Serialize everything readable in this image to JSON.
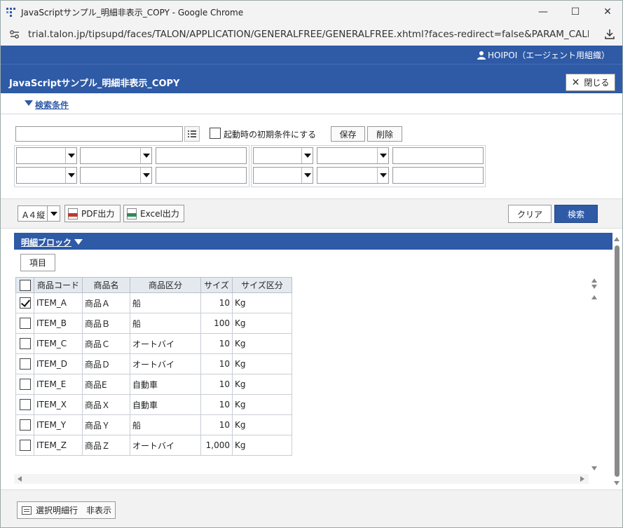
{
  "window": {
    "title": "JavaScriptサンプル_明細非表示_COPY - Google Chrome",
    "minimize": "—",
    "maximize": "☐",
    "close": "✕"
  },
  "address": {
    "url": "trial.talon.jp/tipsupd/faces/TALON/APPLICATION/GENERALFREE/GENERALFREE.xhtml?faces-redirect=false&PARAM_CALL_FUN..."
  },
  "header": {
    "user": "HOIPOI（エージェント用組織）",
    "title": "JavaScriptサンプル_明細非表示_COPY",
    "close_label": "閉じる"
  },
  "search": {
    "section_label": "検索条件",
    "cond_name_value": "",
    "initial_cond_label": "起動時の初期条件にする",
    "save_label": "保存",
    "delete_label": "削除"
  },
  "toolbar": {
    "paper_size": "A４縦",
    "pdf_label": "PDF出力",
    "excel_label": "Excel出力",
    "clear_label": "クリア",
    "search_label": "検索"
  },
  "detail": {
    "section_label": "明細ブロック",
    "items_label": "項目",
    "columns": [
      "商品コード",
      "商品名",
      "商品区分",
      "サイズ",
      "サイズ区分"
    ],
    "rows": [
      {
        "checked": true,
        "code": "ITEM_A",
        "name": "商品Ａ",
        "category": "船",
        "size": "10",
        "unit": "Kg"
      },
      {
        "checked": false,
        "code": "ITEM_B",
        "name": "商品Ｂ",
        "category": "船",
        "size": "100",
        "unit": "Kg"
      },
      {
        "checked": false,
        "code": "ITEM_C",
        "name": "商品Ｃ",
        "category": "オートバイ",
        "size": "10",
        "unit": "Kg"
      },
      {
        "checked": false,
        "code": "ITEM_D",
        "name": "商品Ｄ",
        "category": "オートバイ",
        "size": "10",
        "unit": "Kg"
      },
      {
        "checked": false,
        "code": "ITEM_E",
        "name": "商品E",
        "category": "自動車",
        "size": "10",
        "unit": "Kg"
      },
      {
        "checked": false,
        "code": "ITEM_X",
        "name": "商品Ｘ",
        "category": "自動車",
        "size": "10",
        "unit": "Kg"
      },
      {
        "checked": false,
        "code": "ITEM_Y",
        "name": "商品Ｙ",
        "category": "船",
        "size": "10",
        "unit": "Kg"
      },
      {
        "checked": false,
        "code": "ITEM_Z",
        "name": "商品Ｚ",
        "category": "オートバイ",
        "size": "1,000",
        "unit": "Kg"
      }
    ]
  },
  "footer": {
    "hide_rows_label": "選択明細行　非表示"
  },
  "colors": {
    "brand_blue": "#2e5aa6"
  }
}
